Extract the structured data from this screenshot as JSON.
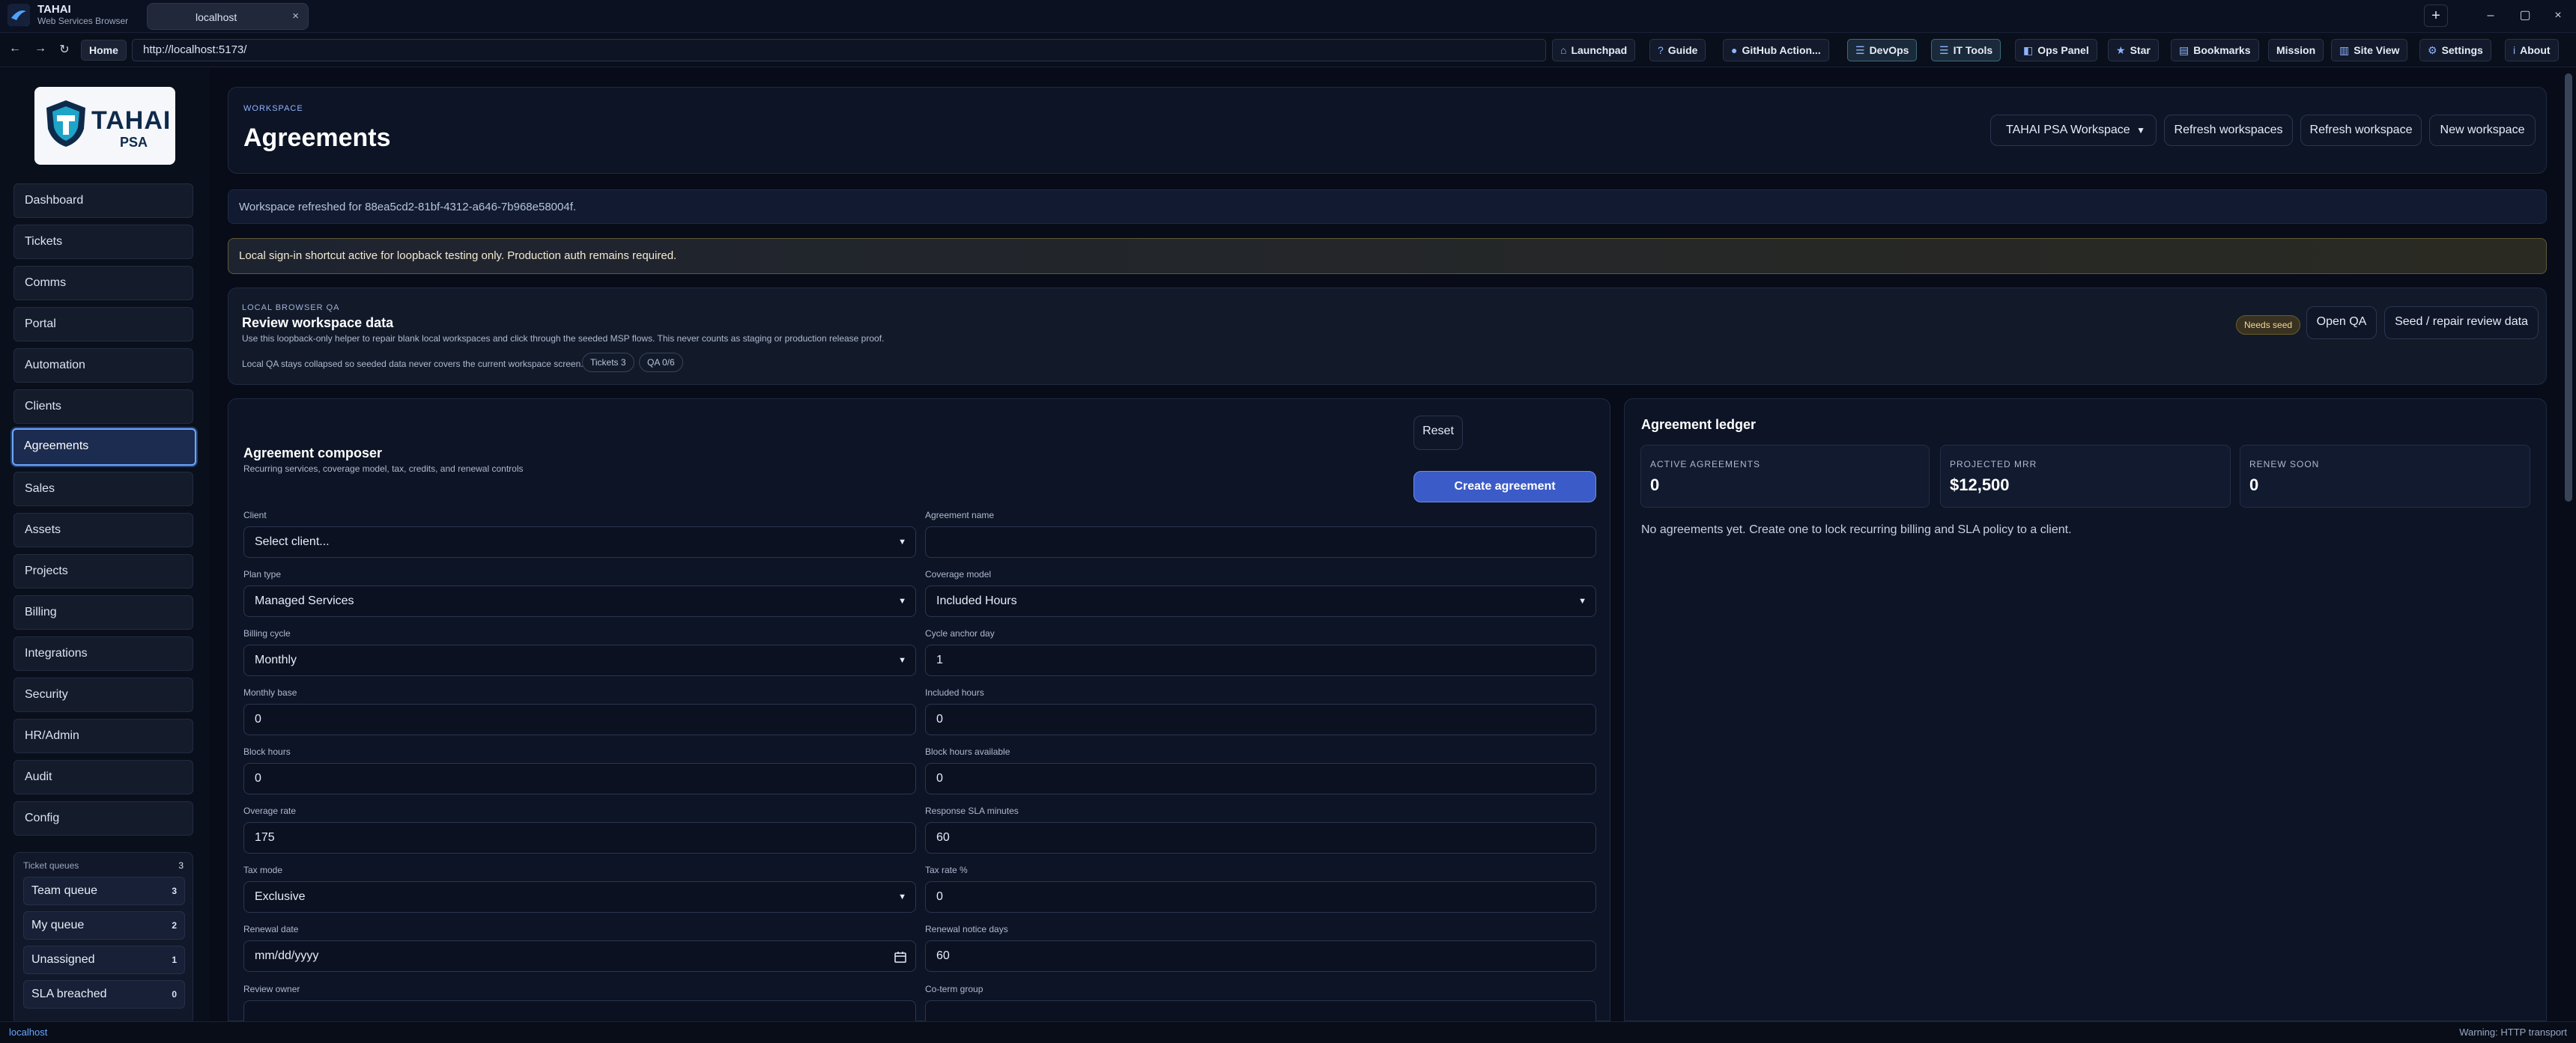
{
  "browser": {
    "name": "TAHAI",
    "subtitle": "Web Services Browser",
    "tab_title": "localhost",
    "tab_close": "×",
    "new_tab": "+",
    "url": "http://localhost:5173/",
    "home_label": "Home",
    "window_controls": [
      "–",
      "▢",
      "×"
    ],
    "nav_icons": [
      "←",
      "→",
      "↻"
    ],
    "toolbar": [
      {
        "icon": "⌂",
        "label": "Launchpad"
      },
      {
        "icon": "?",
        "label": "Guide"
      },
      {
        "icon": "●",
        "label": "GitHub Action..."
      },
      {
        "icon": "☰",
        "label": "DevOps"
      },
      {
        "icon": "☰",
        "label": "IT Tools"
      },
      {
        "icon": "◧",
        "label": "Ops Panel"
      },
      {
        "icon": "★",
        "label": "Star"
      },
      {
        "icon": "▤",
        "label": "Bookmarks"
      },
      {
        "icon": "",
        "label": "Mission"
      },
      {
        "icon": "▥",
        "label": "Site View"
      },
      {
        "icon": "⚙",
        "label": "Settings"
      },
      {
        "icon": "i",
        "label": "About"
      }
    ]
  },
  "logo": {
    "name": "TAHAI",
    "sub": "PSA"
  },
  "sidebar": {
    "items": [
      "Dashboard",
      "Tickets",
      "Comms",
      "Portal",
      "Automation",
      "Clients",
      "Agreements",
      "Sales",
      "Assets",
      "Projects",
      "Billing",
      "Integrations",
      "Security",
      "HR/Admin",
      "Audit",
      "Config"
    ],
    "active": "Agreements",
    "queues": {
      "heading": "Ticket queues",
      "count": "3",
      "items": [
        {
          "label": "Team queue",
          "count": "3"
        },
        {
          "label": "My queue",
          "count": "2"
        },
        {
          "label": "Unassigned",
          "count": "1"
        },
        {
          "label": "SLA breached",
          "count": "0"
        }
      ]
    }
  },
  "header": {
    "eyebrow": "WORKSPACE",
    "title": "Agreements",
    "workspace_select": "TAHAI PSA Workspace",
    "buttons": [
      "Refresh workspaces",
      "Refresh workspace",
      "New workspace"
    ]
  },
  "banners": {
    "refreshed": "Workspace refreshed for 88ea5cd2-81bf-4312-a646-7b968e58004f.",
    "signin": "Local sign-in shortcut active for loopback testing only. Production auth remains required."
  },
  "qa": {
    "eyebrow": "LOCAL BROWSER QA",
    "title": "Review workspace data",
    "description": "Use this loopback-only helper to repair blank local workspaces and click through the seeded MSP flows. This never counts as staging or production release proof.",
    "note": "Local QA stays collapsed so seeded data never covers the current workspace screen.",
    "chips": [
      "Tickets 3",
      "QA 0/6"
    ],
    "badge": "Needs seed",
    "buttons": [
      "Open QA",
      "Seed / repair review data"
    ]
  },
  "composer": {
    "title": "Agreement composer",
    "subtitle": "Recurring services, coverage model, tax, credits, and renewal controls",
    "reset": "Reset",
    "create": "Create agreement",
    "fields": {
      "client": {
        "label": "Client",
        "value": "Select client..."
      },
      "agreement_name": {
        "label": "Agreement name",
        "value": ""
      },
      "plan_type": {
        "label": "Plan type",
        "value": "Managed Services"
      },
      "coverage_model": {
        "label": "Coverage model",
        "value": "Included Hours"
      },
      "billing_cycle": {
        "label": "Billing cycle",
        "value": "Monthly"
      },
      "cycle_anchor_day": {
        "label": "Cycle anchor day",
        "value": "1"
      },
      "monthly_base": {
        "label": "Monthly base",
        "value": "0"
      },
      "included_hours": {
        "label": "Included hours",
        "value": "0"
      },
      "block_hours": {
        "label": "Block hours",
        "value": "0"
      },
      "block_hours_available": {
        "label": "Block hours available",
        "value": "0"
      },
      "overage_rate": {
        "label": "Overage rate",
        "value": "175"
      },
      "response_sla": {
        "label": "Response SLA minutes",
        "value": "60"
      },
      "tax_mode": {
        "label": "Tax mode",
        "value": "Exclusive"
      },
      "tax_rate": {
        "label": "Tax rate %",
        "value": "0"
      },
      "renewal_date": {
        "label": "Renewal date",
        "value": "mm/dd/yyyy"
      },
      "renewal_notice": {
        "label": "Renewal notice days",
        "value": "60"
      },
      "review_owner": {
        "label": "Review owner",
        "value": ""
      },
      "coterm_group": {
        "label": "Co-term group",
        "value": ""
      }
    }
  },
  "ledger": {
    "title": "Agreement ledger",
    "stats": [
      {
        "label": "ACTIVE AGREEMENTS",
        "value": "0"
      },
      {
        "label": "PROJECTED MRR",
        "value": "$12,500"
      },
      {
        "label": "RENEW SOON",
        "value": "0"
      }
    ],
    "empty": "No agreements yet. Create one to lock recurring billing and SLA policy to a client."
  },
  "status": {
    "left": "localhost",
    "right": "Warning: HTTP transport"
  }
}
